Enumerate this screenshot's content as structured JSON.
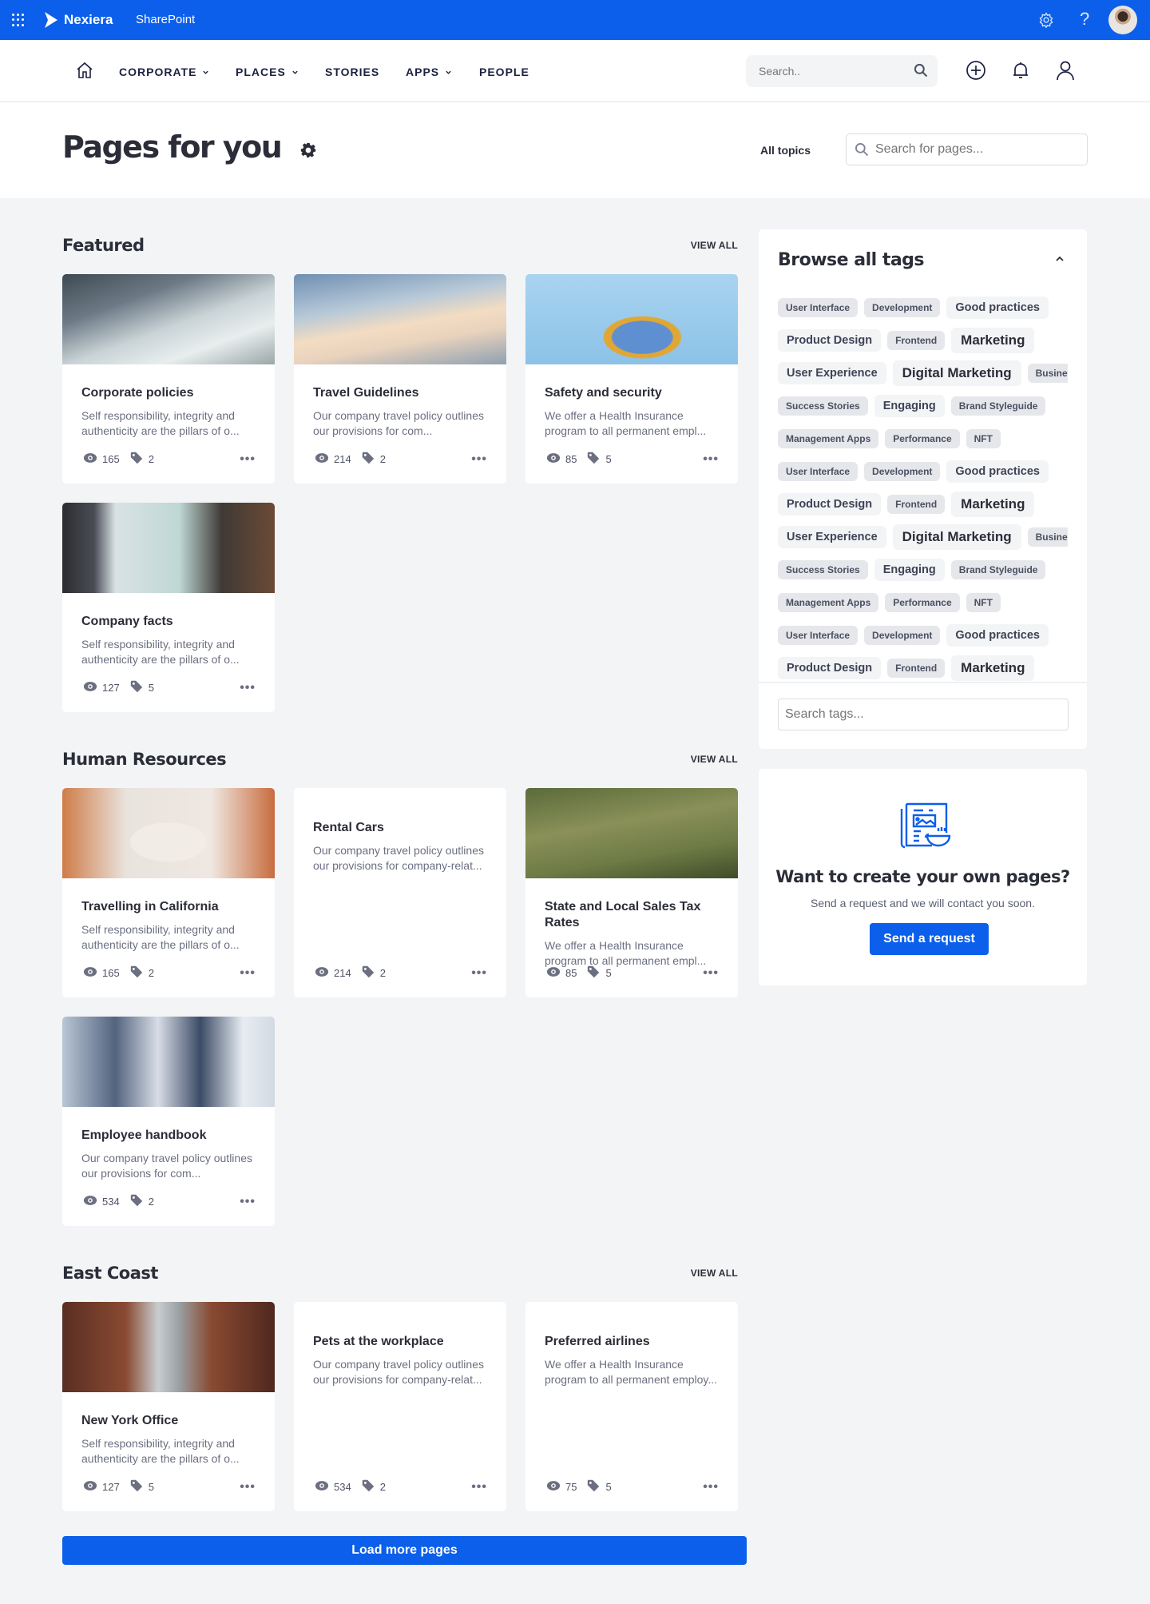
{
  "topbar": {
    "brand": "Nexiera",
    "app": "SharePoint",
    "color": "#0b5fea",
    "icons": [
      "waffle-icon",
      "logo-icon",
      "settings-icon",
      "help-icon",
      "avatar"
    ],
    "help_glyph": "?"
  },
  "nav": {
    "items": [
      {
        "label": "CORPORATE",
        "dropdown": true
      },
      {
        "label": "PLACES",
        "dropdown": true
      },
      {
        "label": "STORIES",
        "dropdown": false
      },
      {
        "label": "APPS",
        "dropdown": true
      },
      {
        "label": "PEOPLE",
        "dropdown": false
      }
    ],
    "search_placeholder": "Search.."
  },
  "header": {
    "title": "Pages for you",
    "topics": "All topics",
    "search_placeholder": "Search for pages..."
  },
  "sections": [
    {
      "title": "Featured",
      "view_all": "VIEW ALL",
      "cards": [
        {
          "title": "Corporate policies",
          "desc": "Self responsibility, integrity and authenticity are the pillars of o...",
          "views": "165",
          "tags": "2",
          "image": "signing-document"
        },
        {
          "title": "Travel Guidelines",
          "desc": "Our company travel policy outlines our provisions for com...",
          "views": "214",
          "tags": "2",
          "image": "airplane-wing"
        },
        {
          "title": "Safety and security",
          "desc": "We offer a Health Insurance program to all permanent empl...",
          "views": "85",
          "tags": "5",
          "image": "workers-ladder"
        },
        {
          "title": "Company facts",
          "desc": "Self responsibility, integrity and authenticity are the pillars of o...",
          "views": "127",
          "tags": "5",
          "image": "laptop-dashboard"
        }
      ]
    },
    {
      "title": "Human Resources",
      "view_all": "VIEW ALL",
      "cards": [
        {
          "title": "Travelling in California",
          "desc": "Self responsibility, integrity and authenticity are the pillars of o...",
          "views": "165",
          "tags": "2",
          "image": "coffee-cup"
        },
        {
          "title": "Rental Cars",
          "desc": "Our company travel policy outlines our provisions for company-relat...",
          "views": "214",
          "tags": "2",
          "image": null
        },
        {
          "title": "State and Local Sales Tax Rates",
          "desc": "We offer a Health Insurance program to all permanent empl...",
          "views": "85",
          "tags": "5",
          "image": "hills-road"
        },
        {
          "title": "Employee handbook",
          "desc": "Our company travel policy outlines our provisions for com...",
          "views": "534",
          "tags": "2",
          "image": "team-photo"
        }
      ]
    },
    {
      "title": "East Coast",
      "view_all": "VIEW ALL",
      "cards": [
        {
          "title": "New York Office",
          "desc": "Self responsibility, integrity and authenticity are the pillars of o...",
          "views": "127",
          "tags": "5",
          "image": "city-bridge"
        },
        {
          "title": "Pets at the workplace",
          "desc": "Our company travel policy outlines our provisions for company-relat...",
          "views": "534",
          "tags": "2",
          "image": null
        },
        {
          "title": "Preferred airlines",
          "desc": "We offer a Health Insurance program to all permanent employ...",
          "views": "75",
          "tags": "5",
          "image": null
        }
      ]
    }
  ],
  "load_more": "Load more pages",
  "tags_panel": {
    "title": "Browse all tags",
    "search_placeholder": "Search tags...",
    "rows": [
      [
        [
          "User Interface",
          "s"
        ],
        [
          "Development",
          "s"
        ],
        [
          "Good practices",
          "m"
        ]
      ],
      [
        [
          "Product Design",
          "m"
        ],
        [
          "Frontend",
          "s"
        ],
        [
          "Marketing",
          "l"
        ]
      ],
      [
        [
          "User Experience",
          "m"
        ],
        [
          "Digital Marketing",
          "l"
        ],
        [
          "Business",
          "s"
        ]
      ],
      [
        [
          "Success Stories",
          "s"
        ],
        [
          "Engaging",
          "m"
        ],
        [
          "Brand Styleguide",
          "s"
        ]
      ],
      [
        [
          "Management Apps",
          "s"
        ],
        [
          "Performance",
          "s"
        ],
        [
          "NFT",
          "s"
        ]
      ],
      [
        [
          "User Interface",
          "s"
        ],
        [
          "Development",
          "s"
        ],
        [
          "Good practices",
          "m"
        ]
      ],
      [
        [
          "Product Design",
          "m"
        ],
        [
          "Frontend",
          "s"
        ],
        [
          "Marketing",
          "l"
        ]
      ],
      [
        [
          "User Experience",
          "m"
        ],
        [
          "Digital Marketing",
          "l"
        ],
        [
          "Business",
          "s"
        ]
      ],
      [
        [
          "Success Stories",
          "s"
        ],
        [
          "Engaging",
          "m"
        ],
        [
          "Brand Styleguide",
          "s"
        ]
      ],
      [
        [
          "Management Apps",
          "s"
        ],
        [
          "Performance",
          "s"
        ],
        [
          "NFT",
          "s"
        ]
      ],
      [
        [
          "User Interface",
          "s"
        ],
        [
          "Development",
          "s"
        ],
        [
          "Good practices",
          "m"
        ]
      ],
      [
        [
          "Product Design",
          "m"
        ],
        [
          "Frontend",
          "s"
        ],
        [
          "Marketing",
          "l"
        ]
      ]
    ]
  },
  "create": {
    "title": "Want to create your own pages?",
    "subtitle": "Send a request and we will contact you soon.",
    "button": "Send a request"
  }
}
